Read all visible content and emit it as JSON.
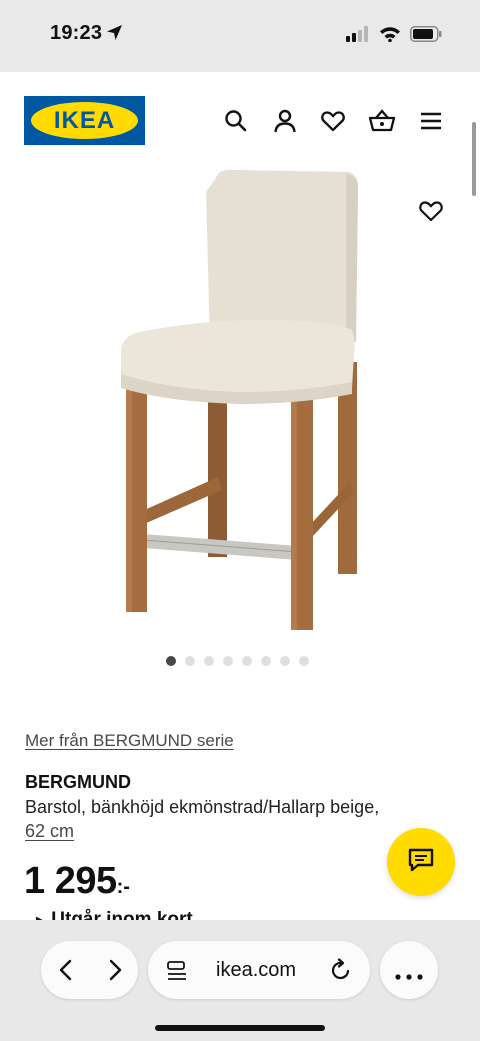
{
  "status_bar": {
    "time": "19:23"
  },
  "header": {
    "logo_text": "IKEA",
    "icons": [
      "search-icon",
      "account-icon",
      "favorites-icon",
      "basket-icon",
      "menu-icon"
    ]
  },
  "gallery": {
    "image_count": 8,
    "active_index": 0
  },
  "product": {
    "series_link": "Mer från BERGMUND serie",
    "name": "BERGMUND",
    "description": "Barstol, bänkhöjd ekmönstrad/Hallarp beige,",
    "size": "62 cm",
    "price": "1 295",
    "price_suffix": ":-",
    "partial_text": "Utgår inom kort"
  },
  "browser": {
    "url": "ikea.com"
  },
  "colors": {
    "brand_blue": "#0058a3",
    "brand_yellow": "#ffdb00"
  }
}
